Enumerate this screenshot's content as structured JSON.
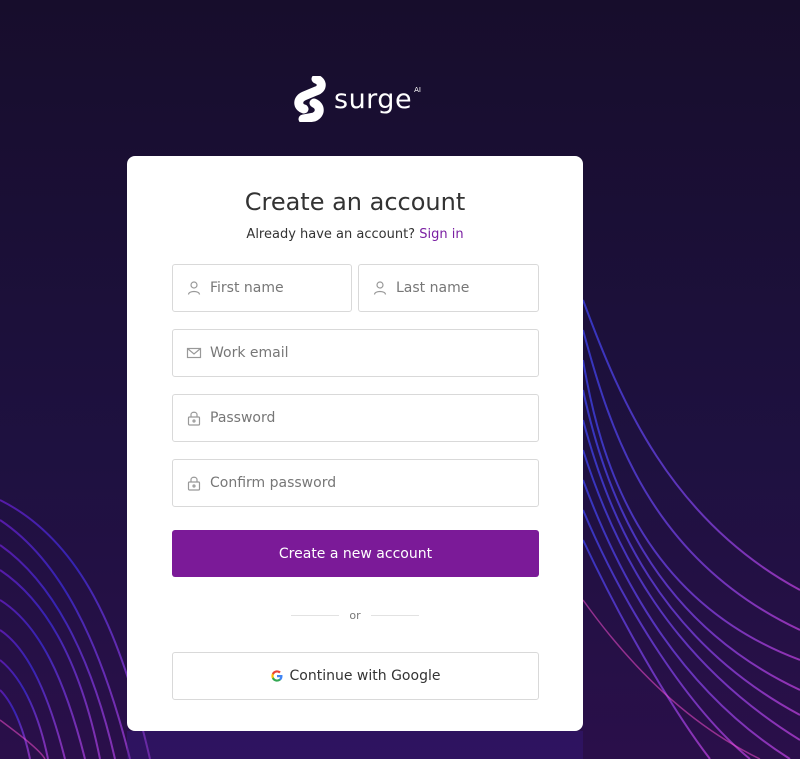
{
  "brand": {
    "name": "surge",
    "superscript": "AI"
  },
  "card": {
    "title": "Create an account",
    "subtitle_text": "Already have an account?",
    "signin_link": "Sign in"
  },
  "form": {
    "first_name": {
      "placeholder": "First name",
      "value": "",
      "icon": "user-icon"
    },
    "last_name": {
      "placeholder": "Last name",
      "value": "",
      "icon": "user-icon"
    },
    "email": {
      "placeholder": "Work email",
      "value": "",
      "icon": "envelope-icon"
    },
    "password": {
      "placeholder": "Password",
      "value": "",
      "icon": "lock-icon"
    },
    "confirm_password": {
      "placeholder": "Confirm password",
      "value": "",
      "icon": "lock-icon"
    },
    "submit_label": "Create a new account"
  },
  "divider_label": "or",
  "google_button": {
    "label": "Continue with Google",
    "icon": "google-icon"
  },
  "colors": {
    "background": "#1a1033",
    "accent": "#7b1a98",
    "link": "#7a1fa2",
    "card": "#ffffff",
    "border": "#d9d9d9"
  }
}
